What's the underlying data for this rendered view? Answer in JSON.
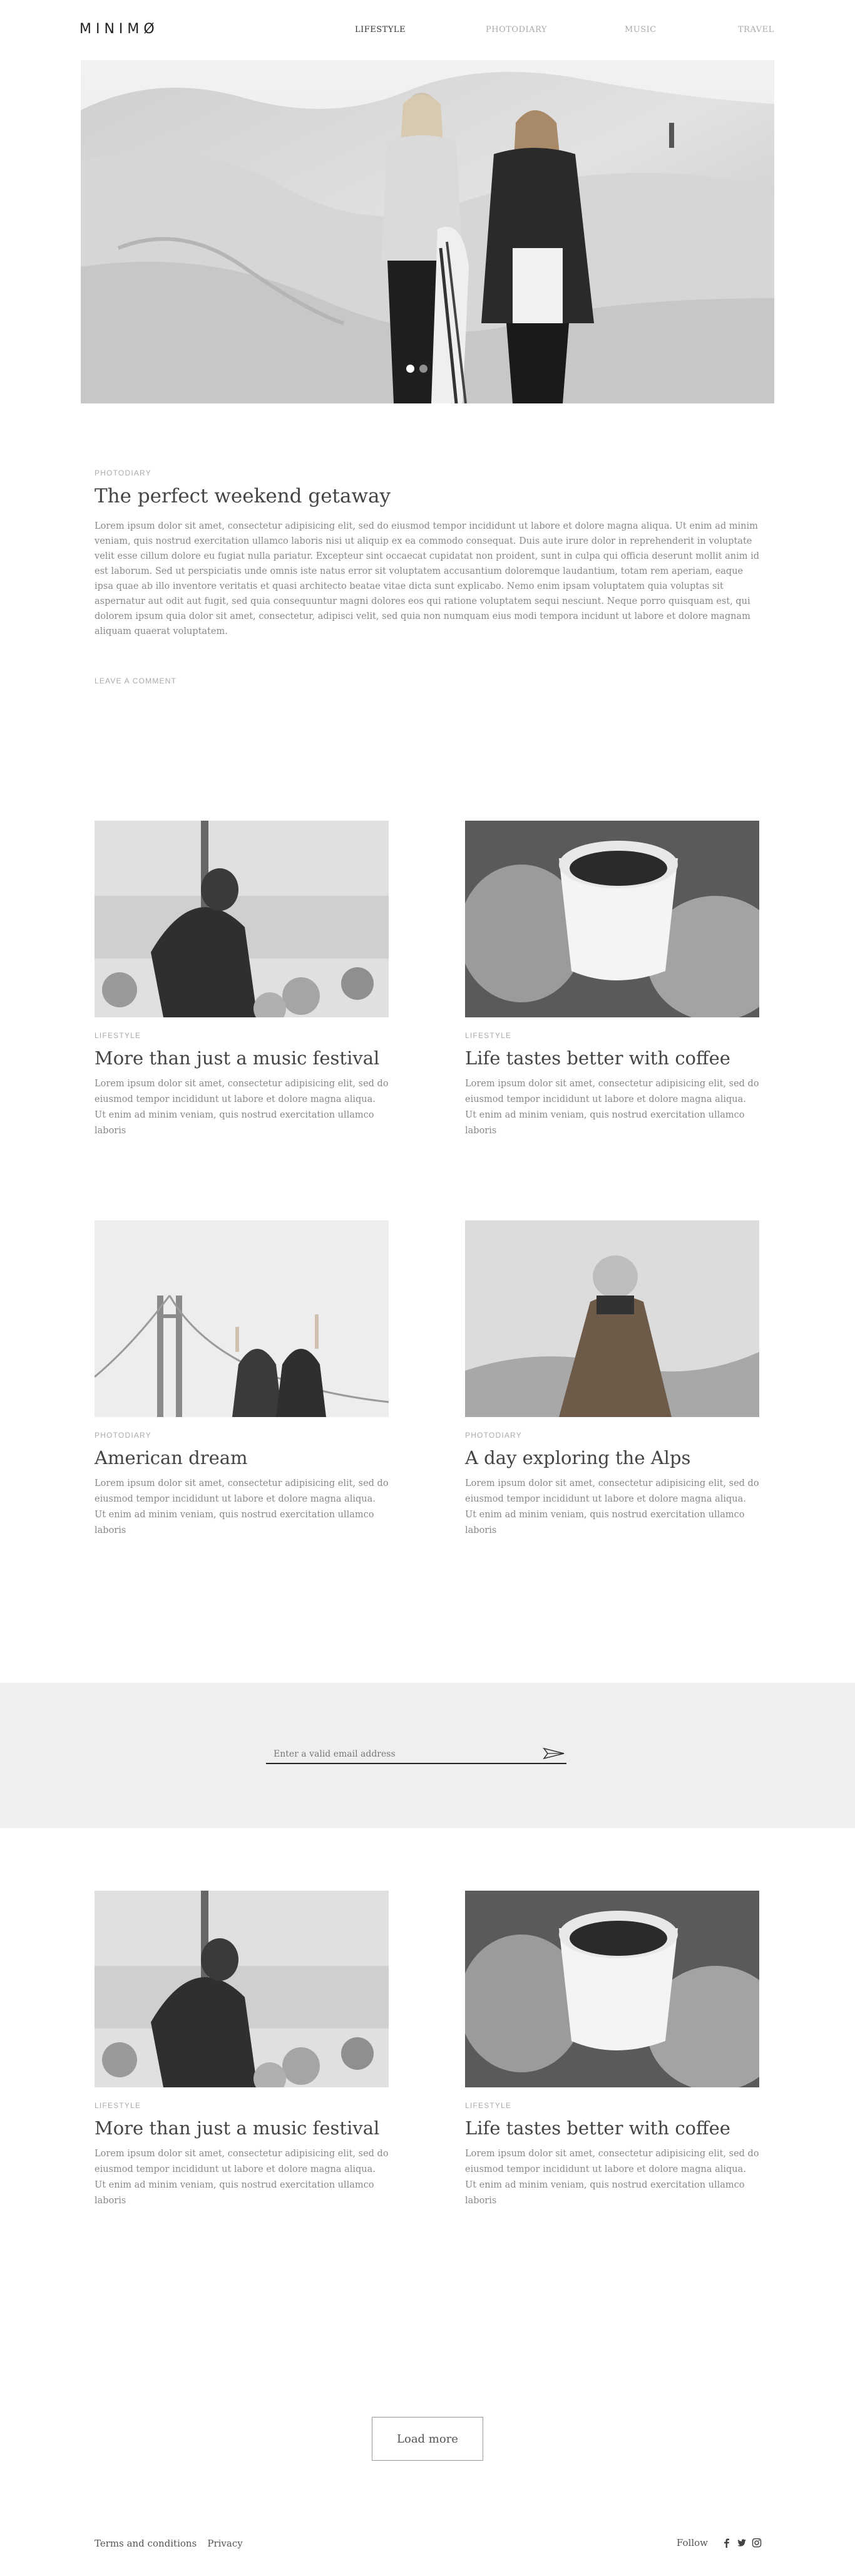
{
  "brand": {
    "logo": "MINIMØ"
  },
  "nav": {
    "items": [
      {
        "label": "LIFESTYLE",
        "active": true
      },
      {
        "label": "PHOTODIARY",
        "active": false
      },
      {
        "label": "MUSIC",
        "active": false
      },
      {
        "label": "TRAVEL",
        "active": false
      }
    ]
  },
  "hero": {
    "slide_count": 2,
    "active_slide": 1
  },
  "featured": {
    "category": "PHOTODIARY",
    "title": "The perfect weekend getaway",
    "body": "Lorem ipsum dolor sit amet, consectetur adipisicing elit, sed do eiusmod tempor incididunt ut labore et dolore magna aliqua. Ut enim ad minim veniam, quis nostrud exercitation ullamco laboris nisi ut aliquip ex ea commodo consequat. Duis aute irure dolor in reprehenderit in voluptate velit esse cillum dolore eu fugiat nulla pariatur. Excepteur sint occaecat cupidatat non proident, sunt in culpa qui officia deserunt mollit anim id est laborum. Sed ut perspiciatis unde omnis iste natus error sit voluptatem accusantium doloremque laudantium, totam rem aperiam, eaque ipsa quae ab illo inventore veritatis et quasi architecto beatae vitae dicta sunt explicabo. Nemo enim ipsam voluptatem quia voluptas sit aspernatur aut odit aut fugit, sed quia consequuntur magni dolores eos qui ratione voluptatem sequi nesciunt. Neque porro quisquam est, qui dolorem ipsum quia dolor sit amet, consectetur, adipisci velit, sed quia non numquam eius modi tempora incidunt ut labore et dolore magnam aliquam quaerat voluptatem.",
    "comment_link": "LEAVE A COMMENT"
  },
  "posts": [
    {
      "category": "LIFESTYLE",
      "title": "More than just a music festival",
      "body": "Lorem ipsum dolor sit amet, consectetur adipisicing elit, sed do eiusmod tempor incididunt ut labore et dolore magna aliqua. Ut enim ad minim veniam, quis nostrud exercitation ullamco laboris"
    },
    {
      "category": "LIFESTYLE",
      "title": "Life tastes better with coffee",
      "body": "Lorem ipsum dolor sit amet, consectetur adipisicing elit, sed do eiusmod tempor incididunt ut labore et dolore magna aliqua. Ut enim ad minim veniam, quis nostrud exercitation ullamco laboris"
    },
    {
      "category": "PHOTODIARY",
      "title": "American dream",
      "body": "Lorem ipsum dolor sit amet, consectetur adipisicing elit, sed do eiusmod tempor incididunt ut labore et dolore magna aliqua. Ut enim ad minim veniam, quis nostrud exercitation ullamco laboris"
    },
    {
      "category": "PHOTODIARY",
      "title": "A day exploring the Alps",
      "body": "Lorem ipsum dolor sit amet, consectetur adipisicing elit, sed do eiusmod tempor incididunt ut labore et dolore magna aliqua. Ut enim ad minim veniam, quis nostrud exercitation ullamco laboris"
    },
    {
      "category": "LIFESTYLE",
      "title": "More than just a music festival",
      "body": "Lorem ipsum dolor sit amet, consectetur adipisicing elit, sed do eiusmod tempor incididunt ut labore et dolore magna aliqua. Ut enim ad minim veniam, quis nostrud exercitation ullamco laboris"
    },
    {
      "category": "LIFESTYLE",
      "title": "Life tastes better with coffee",
      "body": "Lorem ipsum dolor sit amet, consectetur adipisicing elit, sed do eiusmod tempor incididunt ut labore et dolore magna aliqua. Ut enim ad minim veniam, quis nostrud exercitation ullamco laboris"
    }
  ],
  "newsletter": {
    "placeholder": "Enter a valid email address",
    "send_icon": "paper-plane-icon"
  },
  "load_more": {
    "label": "Load more"
  },
  "footer": {
    "links": [
      "Terms and conditions",
      "Privacy"
    ],
    "follow_label": "Follow",
    "social_icons": [
      "facebook-icon",
      "twitter-icon",
      "instagram-icon"
    ]
  },
  "colors": {
    "text": "#333333",
    "muted": "#aaaaaa",
    "body": "#888888",
    "newsletter_bg": "#efefef"
  }
}
